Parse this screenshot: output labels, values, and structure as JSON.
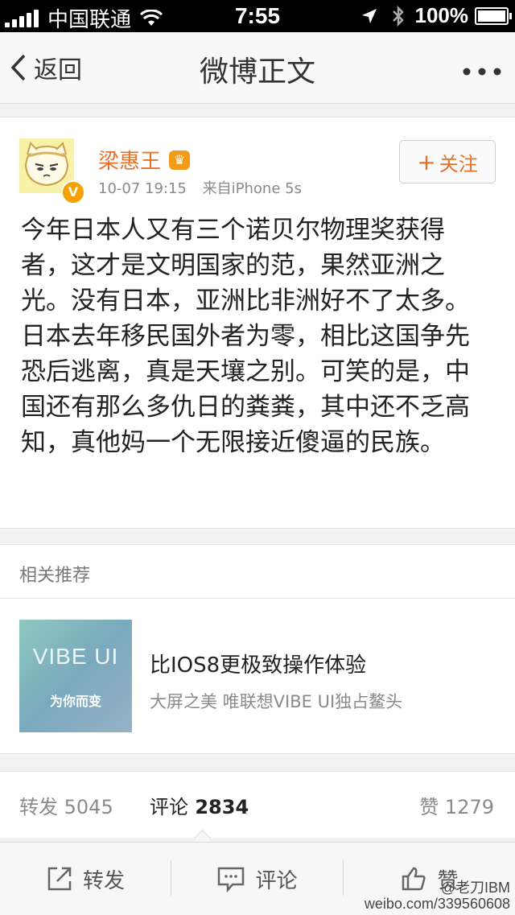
{
  "status_bar": {
    "carrier": "中国联通",
    "time": "7:55",
    "battery": "100%"
  },
  "nav": {
    "back_label": "返回",
    "title": "微博正文"
  },
  "post": {
    "username": "梁惠王",
    "timestamp": "10-07 19:15",
    "source": "来自iPhone 5s",
    "follow_label": "关注",
    "text": "今年日本人又有三个诺贝尔物理奖获得者，这才是文明国家的范，果然亚洲之光。没有日本，亚洲比非洲好不了太多。日本去年移民国外者为零，相比这国争先恐后逃离，真是天壤之别。可笑的是，中国还有那么多仇日的粪粪，其中还不乏高知，真他妈一个无限接近傻逼的民族。"
  },
  "recommend": {
    "section_title": "相关推荐",
    "image_text": "VIBE UI",
    "image_tag": "为你而变",
    "title": "比IOS8更极致操作体验",
    "subtitle": "大屏之美 唯联想VIBE UI独占鳌头"
  },
  "stats": {
    "repost_label": "转发",
    "repost_count": "5045",
    "comment_label": "评论",
    "comment_count": "2834",
    "like_label": "赞",
    "like_count": "1279"
  },
  "toolbar": {
    "repost": "转发",
    "comment": "评论",
    "like": "赞"
  },
  "watermark": {
    "handle": "@老刀IBM",
    "url": "weibo.com/339560608"
  },
  "colors": {
    "accent": "#e8712a",
    "badge": "#f5a200"
  }
}
